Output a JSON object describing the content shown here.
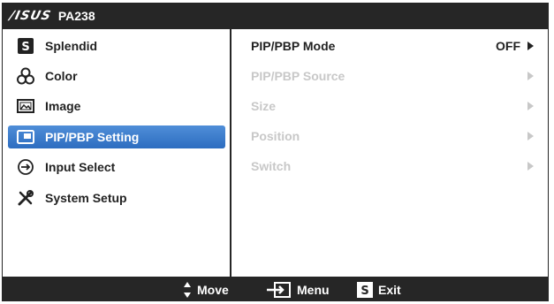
{
  "header": {
    "brand": "/ISUS",
    "model": "PA238"
  },
  "main_menu": {
    "items": [
      {
        "label": "Splendid",
        "icon": "splendid-s-icon",
        "active": false
      },
      {
        "label": "Color",
        "icon": "color-circles-icon",
        "active": false
      },
      {
        "label": "Image",
        "icon": "image-picture-icon",
        "active": false
      },
      {
        "label": "PIP/PBP Setting",
        "icon": "pip-window-icon",
        "active": true
      },
      {
        "label": "Input Select",
        "icon": "input-arrow-icon",
        "active": false
      },
      {
        "label": "System Setup",
        "icon": "tools-wrench-icon",
        "active": false
      }
    ]
  },
  "submenu": {
    "items": [
      {
        "label": "PIP/PBP Mode",
        "value": "OFF",
        "enabled": true
      },
      {
        "label": "PIP/PBP Source",
        "value": "",
        "enabled": false
      },
      {
        "label": "Size",
        "value": "",
        "enabled": false
      },
      {
        "label": "Position",
        "value": "",
        "enabled": false
      },
      {
        "label": "Switch",
        "value": "",
        "enabled": false
      }
    ]
  },
  "footer": {
    "move_label": "Move",
    "menu_label": "Menu",
    "exit_label": "Exit"
  },
  "colors": {
    "osd_dark": "#262626",
    "highlight_blue": "#3a7ccc",
    "disabled_text": "#c8c8c8"
  }
}
